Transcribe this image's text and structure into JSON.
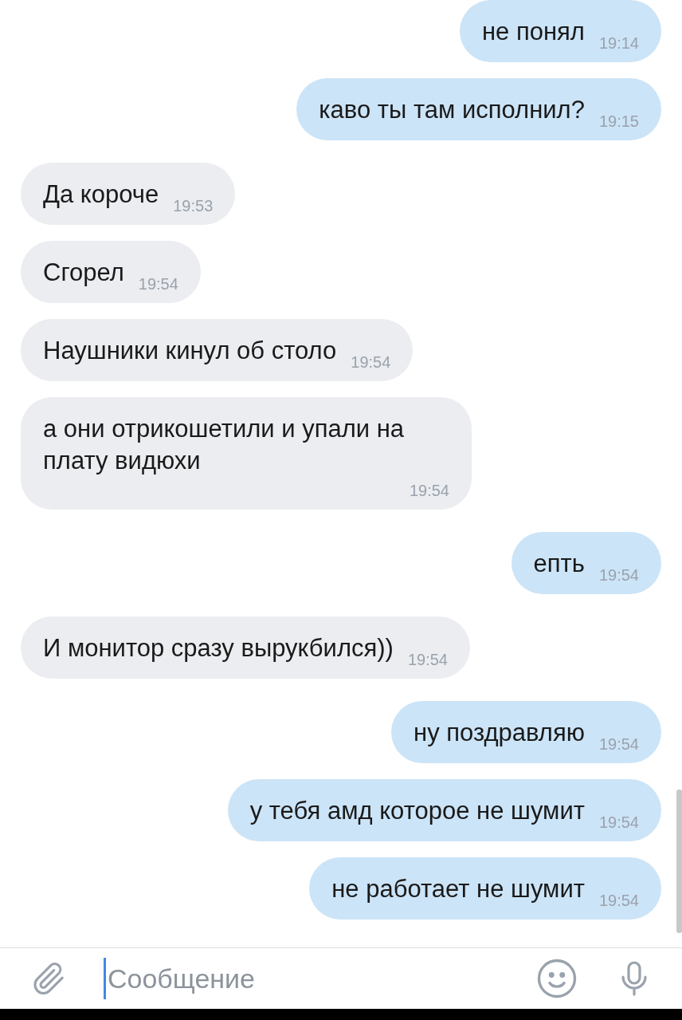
{
  "messages": [
    {
      "kind": "out",
      "text": "не понял",
      "time": "19:14"
    },
    {
      "kind": "out",
      "text": "каво ты там исполнил?",
      "time": "19:15"
    },
    {
      "kind": "in",
      "text": "Да короче",
      "time": "19:53"
    },
    {
      "kind": "in",
      "text": "Сгорел",
      "time": "19:54"
    },
    {
      "kind": "in",
      "text": "Наушники кинул об столо",
      "time": "19:54"
    },
    {
      "kind": "in",
      "text": "а они отрикошетили и упали на плату видюхи",
      "time": "19:54"
    },
    {
      "kind": "out",
      "text": "епть",
      "time": "19:54"
    },
    {
      "kind": "in",
      "text": "И монитор сразу вырукбился))",
      "time": "19:54"
    },
    {
      "kind": "out",
      "text": "ну поздравляю",
      "time": "19:54"
    },
    {
      "kind": "out",
      "text": "у тебя амд которое не шумит",
      "time": "19:54"
    },
    {
      "kind": "out",
      "text": "не работает не шумит",
      "time": "19:54"
    }
  ],
  "composer": {
    "placeholder": "Сообщение"
  }
}
